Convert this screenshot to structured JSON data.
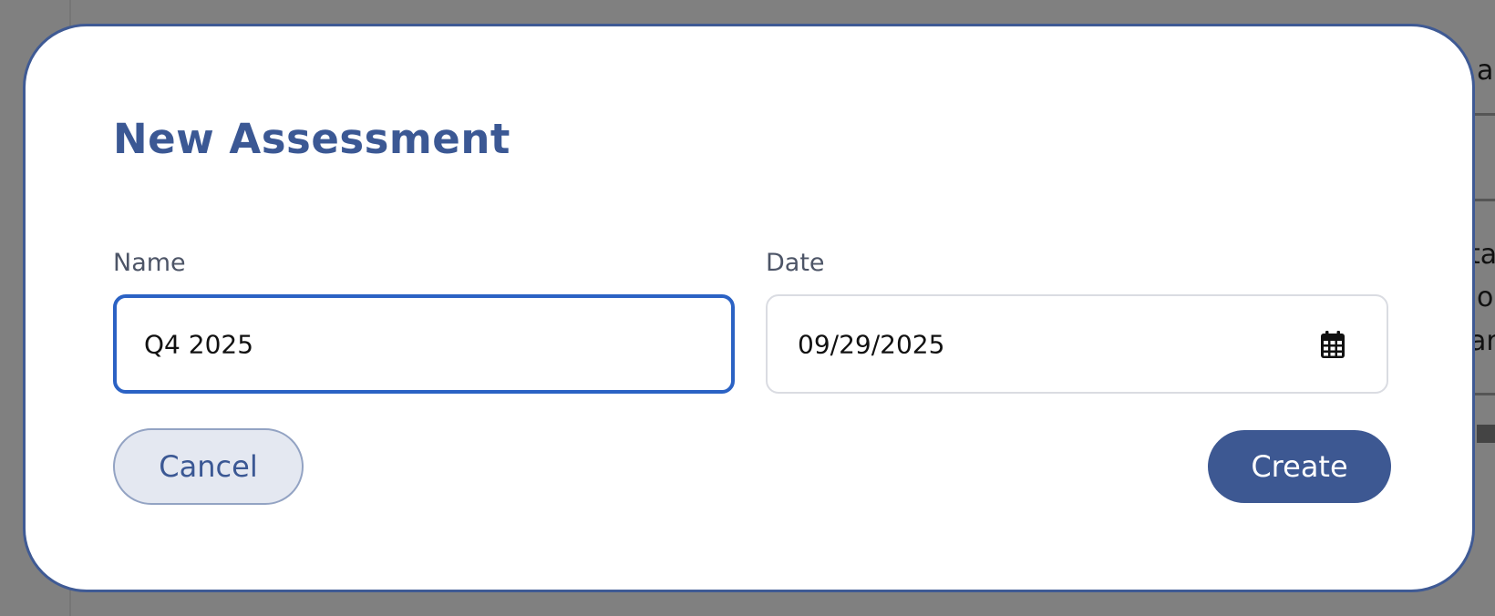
{
  "backdrop": {
    "snippets": [
      "a",
      "ta",
      "o",
      "ar"
    ]
  },
  "dialog": {
    "title": "New Assessment",
    "name_field": {
      "label": "Name",
      "value": "Q4 2025"
    },
    "date_field": {
      "label": "Date",
      "value": "09/29/2025",
      "icon": "calendar-icon"
    },
    "cancel_label": "Cancel",
    "create_label": "Create"
  },
  "colors": {
    "accent": "#3b5894",
    "focus_border": "#2b62c4",
    "create_button_bg": "#3d5892",
    "cancel_button_bg": "#e4e8f1",
    "overlay": "#808080"
  }
}
